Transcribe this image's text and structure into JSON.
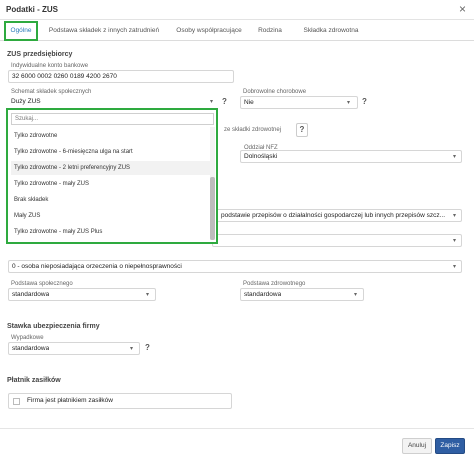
{
  "window": {
    "title": "Podatki - ZUS",
    "close_glyph": "×"
  },
  "tabs": [
    {
      "label": "Ogólne",
      "active": true
    },
    {
      "label": "Podstawa składek z innych zatrudnień",
      "active": false
    },
    {
      "label": "Osoby współpracujące",
      "active": false
    },
    {
      "label": "Rodzina",
      "active": false
    },
    {
      "label": "Składka zdrowotna",
      "active": false
    }
  ],
  "zus": {
    "section_title": "ZUS przedsiębiorcy",
    "account_label": "Indywidualne konto bankowe",
    "account_value": "32 6000 0002 0260 0189 4200 2670",
    "scheme_label": "Schemat składek społecznych",
    "scheme_value": "Duży ZUS",
    "voluntary_label": "Dobrowolne chorobowe",
    "voluntary_value": "Nie",
    "health_note_fragment": "ze składki zdrowotnej",
    "nfz_label": "Oddział NFZ",
    "nfz_value": "Dolnośląski",
    "basis_law_value": "podstawie przepisów o działalności gospodarczej lub innych przepisów szcz...",
    "disability_value": "0 - osoba nieposiadająca orzeczenia o niepełnosprawności",
    "social_basis_label": "Podstawa społecznego",
    "social_basis_value": "standardowa",
    "health_basis_label": "Podstawa zdrowotnego",
    "health_basis_value": "standardowa"
  },
  "dropdown": {
    "search_placeholder": "Szukaj...",
    "options": [
      "Tylko zdrowotne",
      "Tylko zdrowotne - 6-miesięczna ulga na start",
      "Tylko zdrowotne - 2 letni preferencyjny ZUS",
      "Tylko zdrowotne - mały ZUS",
      "Brak składek",
      "Mały ZUS",
      "Tylko zdrowotne - mały ZUS Plus"
    ],
    "highlighted_index": 2
  },
  "rate": {
    "section_title": "Stawka ubezpieczenia firmy",
    "accident_label": "Wypadkowe",
    "accident_value": "standardowa"
  },
  "payer": {
    "section_title": "Płatnik zasiłków",
    "checkbox_label": "Firma jest płatnikiem zasiłków",
    "checked": false
  },
  "buttons": {
    "cancel": "Anuluj",
    "save": "Zapisz"
  },
  "icons": {
    "help": "?",
    "caret": "▾"
  },
  "colors": {
    "highlight_border": "#2eaa3f",
    "primary_button": "#2f5ea3",
    "active_tab_text": "#2a7ab8"
  }
}
